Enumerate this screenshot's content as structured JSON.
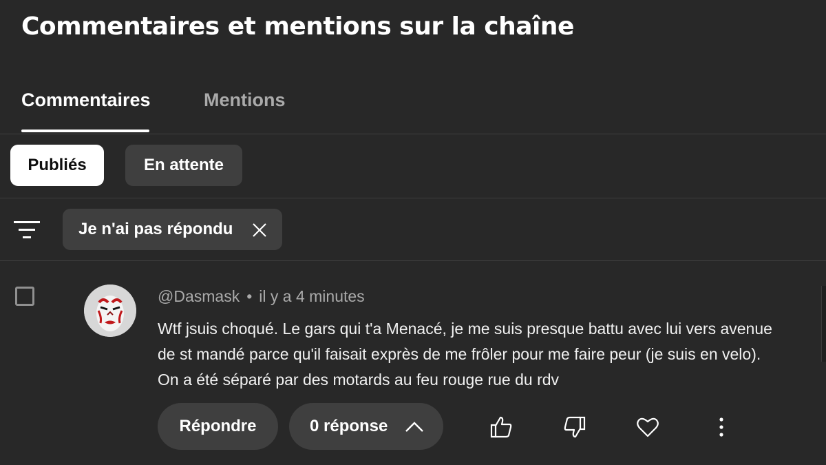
{
  "page": {
    "title": "Commentaires et mentions sur la chaîne"
  },
  "tabs": [
    {
      "label": "Commentaires",
      "active": true
    },
    {
      "label": "Mentions",
      "active": false
    }
  ],
  "status_chips": [
    {
      "label": "Publiés",
      "selected": true
    },
    {
      "label": "En attente",
      "selected": false
    }
  ],
  "filter": {
    "icon": "filter-icon",
    "active_chip": {
      "label": "Je n'ai pas répondu",
      "close_icon": "close-icon"
    }
  },
  "comment": {
    "author": "@Dasmask",
    "separator": "•",
    "time": "il y a 4 minutes",
    "text_lines": [
      "Wtf jsuis choqué. Le gars qui t'a Menacé, je me suis presque battu avec lui vers avenue",
      "de st mandé parce qu'il faisait exprès de me frôler pour me faire peur (je suis en velo).",
      "On a été séparé par des motards au feu rouge rue du rdv"
    ],
    "reply_button": "Répondre",
    "replies_button": "0 réponse",
    "actions": [
      "like-icon",
      "dislike-icon",
      "heart-icon",
      "more-vert-icon"
    ]
  },
  "colors": {
    "background": "#282828",
    "chip_bg": "#3f3f3f",
    "text_primary": "#ffffff",
    "text_secondary": "#aaaaaa",
    "selected_chip_bg": "#ffffff",
    "selected_chip_text": "#0f0f0f"
  }
}
